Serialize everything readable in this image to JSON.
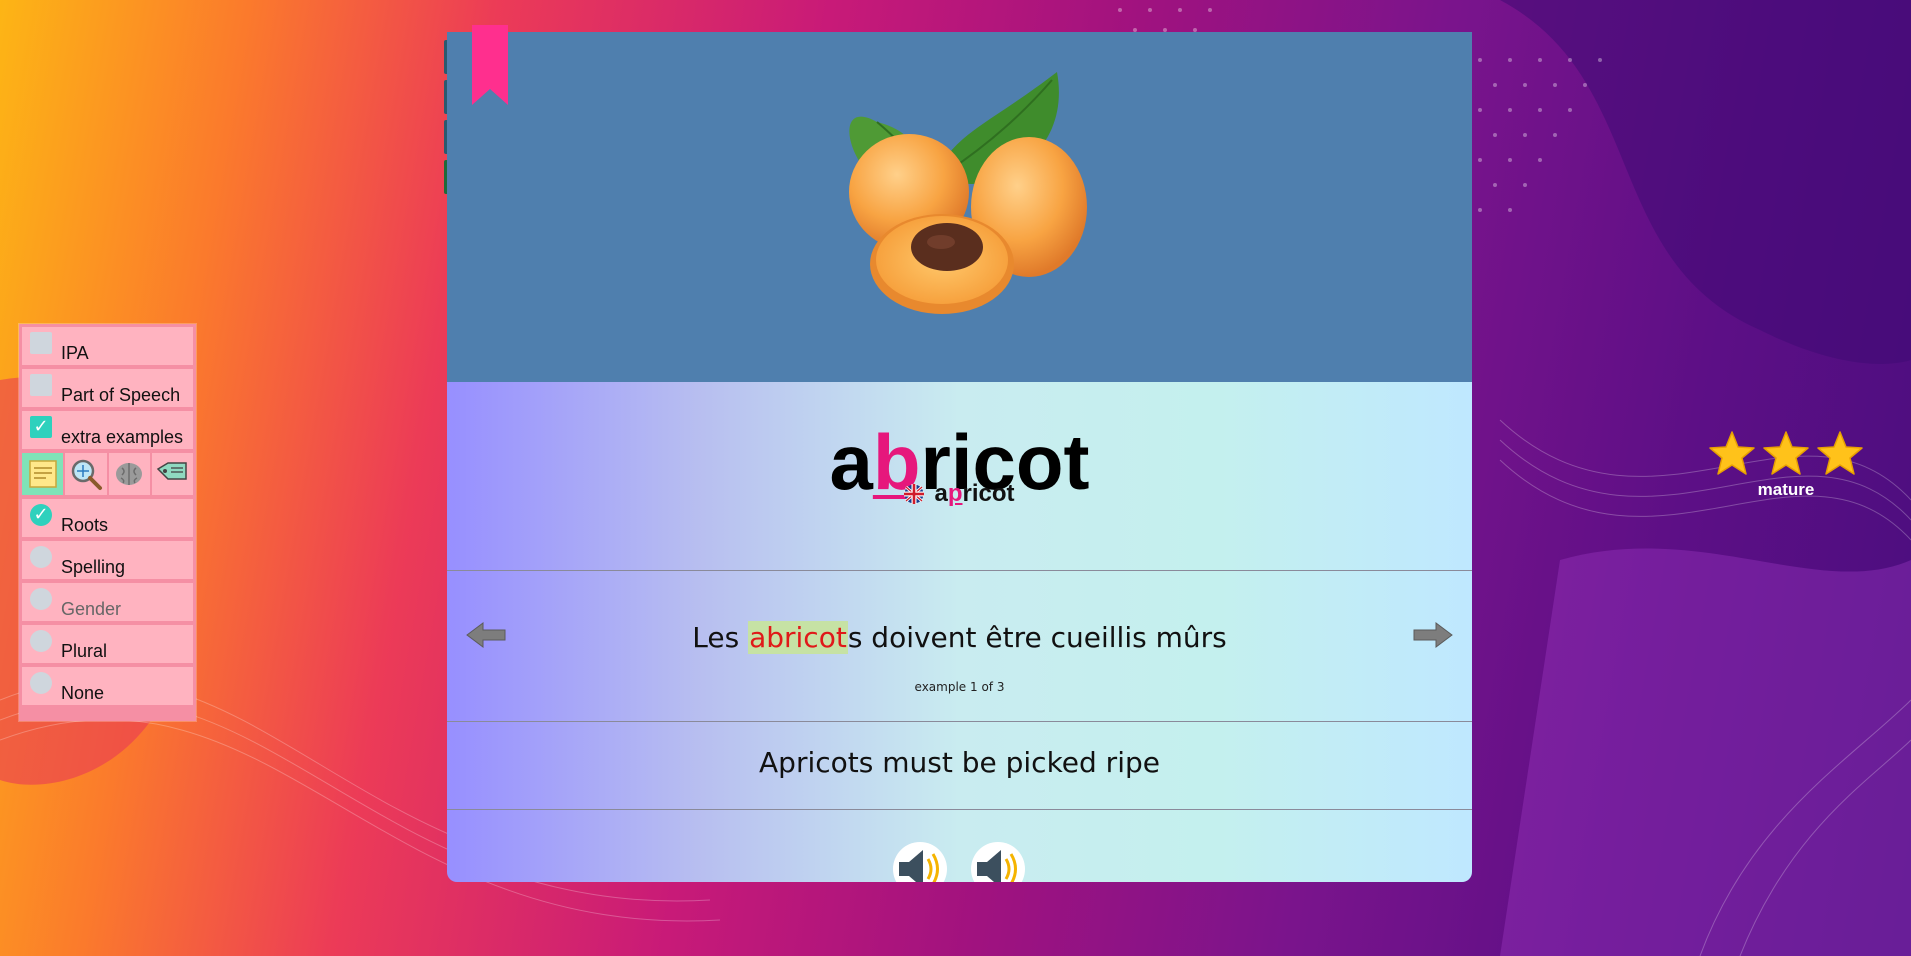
{
  "options": {
    "checkboxes": [
      {
        "label": "IPA",
        "checked": false
      },
      {
        "label": "Part of Speech",
        "checked": false
      },
      {
        "label": "extra examples",
        "checked": true
      }
    ],
    "tools": [
      {
        "icon": "notes-icon",
        "active": true
      },
      {
        "icon": "magnifier-icon",
        "active": false
      },
      {
        "icon": "brain-icon",
        "active": false
      },
      {
        "icon": "tag-icon",
        "active": false
      }
    ],
    "radios": [
      {
        "label": "Roots",
        "selected": true,
        "dim": false
      },
      {
        "label": "Spelling",
        "selected": false,
        "dim": false
      },
      {
        "label": "Gender",
        "selected": false,
        "dim": true
      },
      {
        "label": "Plural",
        "selected": false,
        "dim": false
      },
      {
        "label": "None",
        "selected": false,
        "dim": false
      }
    ]
  },
  "card": {
    "image_alt": "apricot-image",
    "word": {
      "before": "a",
      "highlight": "b",
      "after": "ricot"
    },
    "translation": {
      "before": "a",
      "highlight": "p",
      "after": "ricot"
    },
    "example": {
      "before": "Les ",
      "highlight": "abricot",
      "after": "s doivent être cueillis mûrs"
    },
    "example_counter": "example 1 of 3",
    "example_translation": "Apricots must be picked ripe"
  },
  "rating": {
    "stars": 3,
    "label": "mature",
    "star_color": "#ffc21a"
  },
  "colors": {
    "accent": "#e6177c",
    "checkbox_on": "#2ed1bd",
    "hero_bg": "#4f7fae",
    "panel_bg": "#ffb3c0"
  }
}
